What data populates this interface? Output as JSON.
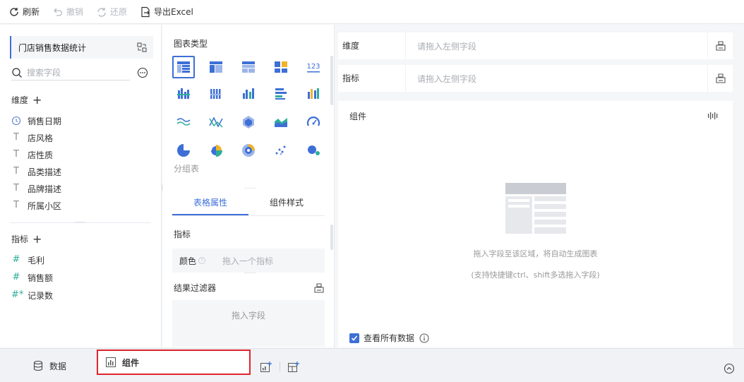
{
  "toolbar": {
    "refresh": "刷新",
    "undo": "撤销",
    "redo": "还原",
    "export": "导出Excel"
  },
  "left_panel": {
    "dataset": "门店销售数据统计",
    "search_placeholder": "搜索字段",
    "dimension_title": "维度",
    "dimensions": [
      {
        "icon": "clock-icon",
        "label": "销售日期"
      },
      {
        "icon": "text-type-icon",
        "label": "店风格"
      },
      {
        "icon": "text-type-icon",
        "label": "店性质"
      },
      {
        "icon": "text-type-icon",
        "label": "品类描述"
      },
      {
        "icon": "text-type-icon",
        "label": "品牌描述"
      },
      {
        "icon": "text-type-icon",
        "label": "所属小区"
      }
    ],
    "measure_title": "指标",
    "measures": [
      {
        "icon": "number-type-icon",
        "label": "毛利"
      },
      {
        "icon": "number-type-icon",
        "label": "销售额"
      },
      {
        "icon": "record-count-icon",
        "label": "记录数"
      }
    ]
  },
  "middle_panel": {
    "chart_type_title": "图表类型",
    "selected_chart_label": "分组表",
    "tabs": [
      "表格属性",
      "组件样式"
    ],
    "active_tab": "表格属性",
    "measure_title": "指标",
    "color_label": "颜色",
    "color_placeholder": "拖入一个指标",
    "filter_title": "结果过滤器",
    "filter_placeholder": "拖入字段"
  },
  "right_panel": {
    "dimension_slot": {
      "label": "维度",
      "placeholder": "请拖入左侧字段"
    },
    "measure_slot": {
      "label": "指标",
      "placeholder": "请拖入左侧字段"
    },
    "component_title": "组件",
    "hint_primary": "拖入字段至该区域，将自动生成图表",
    "hint_secondary": "(支持快捷键ctrl、shift多选拖入字段)",
    "view_all_label": "查看所有数据",
    "view_all_checked": true
  },
  "bottom_bar": {
    "data_tab": "数据",
    "component_tab": "组件"
  },
  "colors": {
    "accent": "#3d6fd6",
    "highlight_border": "#e0242d"
  }
}
